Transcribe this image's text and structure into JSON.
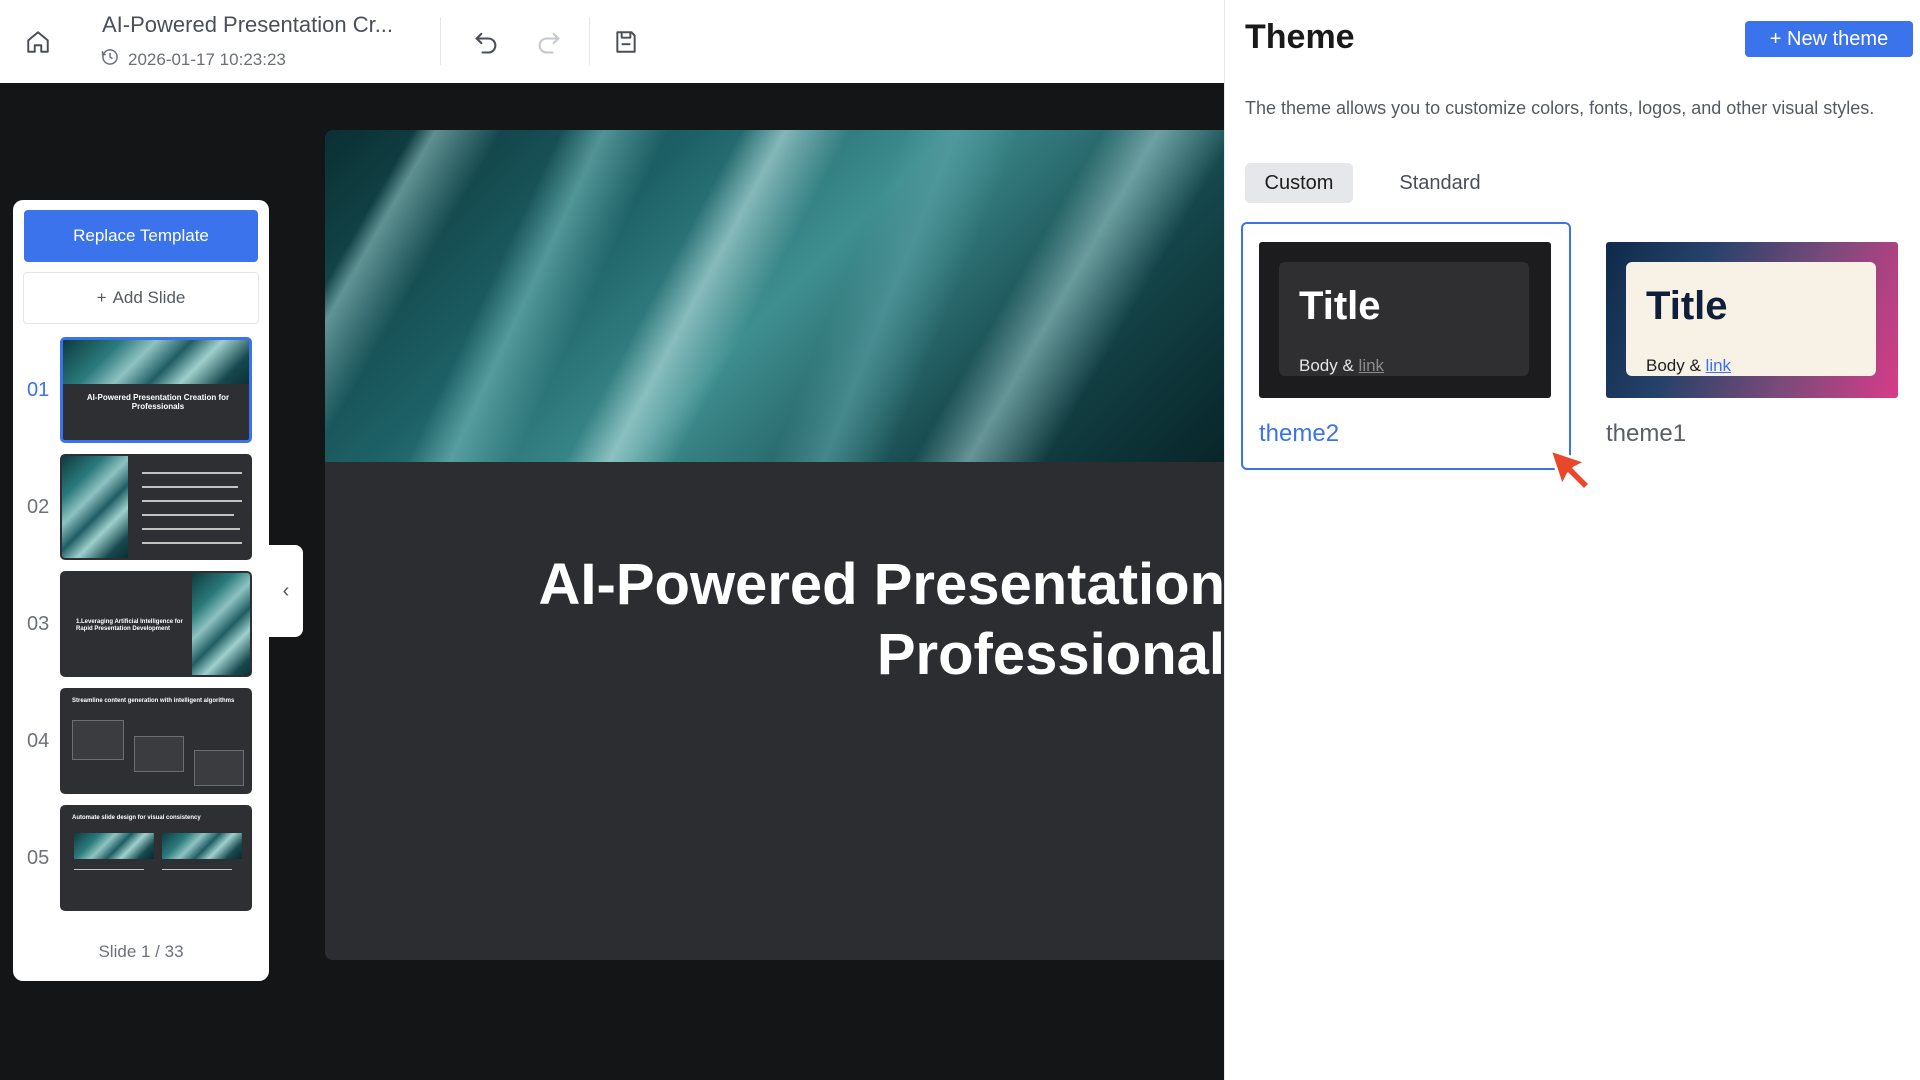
{
  "toolbar": {
    "doc_title": "AI-Powered Presentation Cr...",
    "timestamp": "2026-01-17 10:23:23",
    "icons": [
      "home-icon",
      "history-icon",
      "undo-icon",
      "redo-icon",
      "save-icon"
    ]
  },
  "slide_panel": {
    "replace_template_label": "Replace Template",
    "add_slide_label": "Add Slide",
    "slides": [
      {
        "num": "01",
        "text": "AI-Powered Presentation Creation for Professionals"
      },
      {
        "num": "02",
        "text": ""
      },
      {
        "num": "03",
        "text": "1.Leveraging Artificial Intelligence for Rapid Presentation Development"
      },
      {
        "num": "04",
        "text": "Streamline content generation with intelligent algorithms"
      },
      {
        "num": "05",
        "text": "Automate slide design for visual consistency"
      }
    ],
    "counter": "Slide 1 / 33"
  },
  "slide_canvas": {
    "title_line1": "AI-Powered Presentation",
    "title_line2": "Professional"
  },
  "theme_panel": {
    "heading": "Theme",
    "new_theme_label": "+ New theme",
    "description": "The theme allows you to customize colors, fonts, logos, and other visual styles.",
    "tabs": [
      {
        "label": "Custom",
        "active": true
      },
      {
        "label": "Standard",
        "active": false
      }
    ],
    "themes": [
      {
        "name": "theme2",
        "preview_title": "Title",
        "preview_body": "Body &",
        "preview_link": "link",
        "selected": true
      },
      {
        "name": "theme1",
        "preview_title": "Title",
        "preview_body": "Body &",
        "preview_link": "link",
        "selected": false
      }
    ]
  },
  "colors": {
    "accent": "#3a73ec",
    "editor_bg": "#141517",
    "slide_bg": "#2c2d30"
  }
}
